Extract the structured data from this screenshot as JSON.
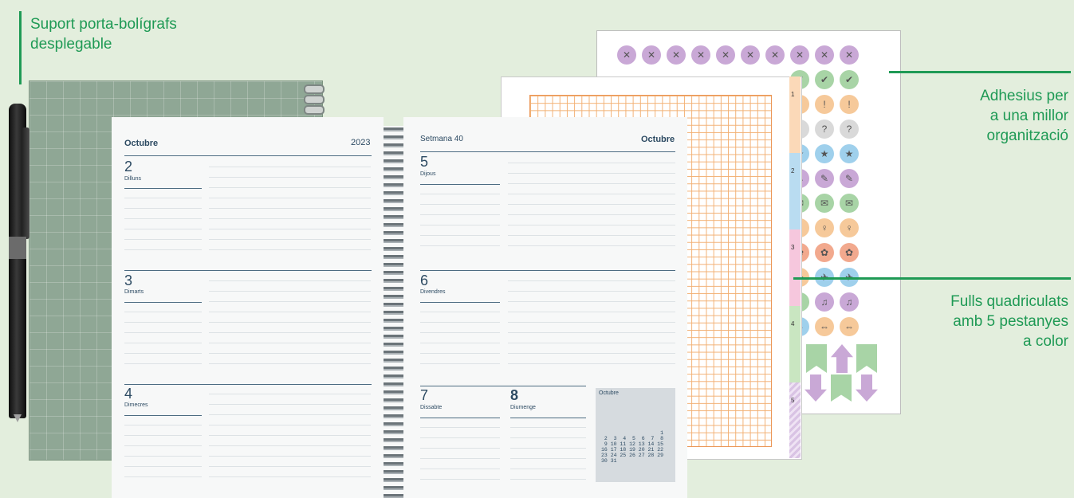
{
  "callouts": {
    "pen_holder": [
      "Suport porta-bolígrafs",
      "desplegable"
    ],
    "stickers": [
      "Adhesius per",
      "a una millor",
      "organització"
    ],
    "grid_sheets": [
      "Fulls quadriculats",
      "amb 5 pestanyes",
      "a color"
    ]
  },
  "left_page": {
    "month": "Octubre",
    "year": "2023",
    "days": [
      {
        "num": "2",
        "name": "Dilluns"
      },
      {
        "num": "3",
        "name": "Dimarts"
      },
      {
        "num": "4",
        "name": "Dimecres"
      }
    ]
  },
  "right_page": {
    "week": "Setmana 40",
    "month": "Octubre",
    "days": [
      {
        "num": "5",
        "name": "Dijous"
      },
      {
        "num": "6",
        "name": "Divendres"
      },
      {
        "num": "7",
        "name": "Dissabte"
      },
      {
        "num": "8",
        "name": "Diumenge"
      }
    ],
    "mini_calendar": {
      "title": "Octubre",
      "rows": [
        "                   1",
        " 2  3  4  5  6  7  8",
        " 9 10 11 12 13 14 15",
        "16 17 18 19 20 21 22",
        "23 24 25 26 27 28 29",
        "30 31"
      ]
    }
  },
  "tabs": [
    "1",
    "2",
    "3",
    "4",
    "5"
  ],
  "sticker_rows": [
    {
      "symbol": "✕",
      "colors": [
        "#c9a8d6",
        "#c9a8d6",
        "#c9a8d6",
        "#c9a8d6",
        "#c9a8d6",
        "#c9a8d6",
        "#c9a8d6",
        "#c9a8d6",
        "#c9a8d6",
        "#c9a8d6"
      ]
    },
    {
      "symbol": "✔",
      "colors": [
        "#a8d4a6",
        "#a8d4a6",
        "#a8d4a6"
      ]
    },
    {
      "symbol": "!",
      "colors": [
        "#f6c99a",
        "#f6c99a",
        "#f6c99a"
      ]
    },
    {
      "symbol": "?",
      "colors": [
        "#d9d9d9",
        "#d9d9d9",
        "#d9d9d9"
      ]
    },
    {
      "symbol": "★",
      "colors": [
        "#9fd0ec",
        "#9fd0ec",
        "#9fd0ec"
      ]
    },
    {
      "symbol": "✎",
      "colors": [
        "#c9a8d6",
        "#c9a8d6",
        "#c9a8d6"
      ]
    },
    {
      "symbol": "✉",
      "colors": [
        "#a8d4a6",
        "#a8d4a6",
        "#a8d4a6"
      ]
    },
    {
      "symbol": "♀",
      "colors": [
        "#f6c99a",
        "#f6c99a",
        "#f6c99a"
      ]
    },
    {
      "symbol": "✿",
      "colors": [
        "#f2a98e",
        "#f2a98e",
        "#f2a98e"
      ]
    },
    {
      "symbol": "✈",
      "colors": [
        "#f6c99a",
        "#9fd0ec",
        "#9fd0ec"
      ]
    },
    {
      "symbol": "♫",
      "colors": [
        "#a8d4a6",
        "#c9a8d6",
        "#c9a8d6"
      ]
    },
    {
      "symbol": "⇔",
      "colors": [
        "#9fd0ec",
        "#f6c99a",
        "#f6c99a"
      ]
    }
  ]
}
